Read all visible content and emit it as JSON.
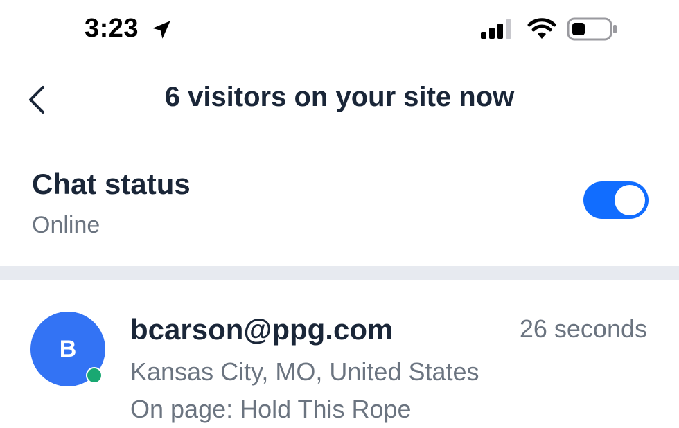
{
  "status_bar": {
    "time": "3:23",
    "location_icon": "location-arrow-icon",
    "signal_icon": "cellular-signal-icon",
    "wifi_icon": "wifi-icon",
    "battery_icon": "battery-icon",
    "battery_level_fraction": 0.3
  },
  "header": {
    "back_icon": "chevron-left-icon",
    "title": "6 visitors on your site now"
  },
  "chat_status": {
    "title": "Chat status",
    "status": "Online",
    "toggle_on": true,
    "toggle_color": "#116dff"
  },
  "visitors": [
    {
      "initial": "B",
      "email": "bcarson@ppg.com",
      "time_ago": "26 seconds",
      "location": "Kansas City, MO, United States",
      "page": "On page: Hold This Rope",
      "online": true,
      "avatar_color": "#3373f4",
      "online_color": "#19a872"
    }
  ],
  "colors": {
    "divider": "#e7eaf0",
    "primary_text": "#1a2638",
    "secondary_text": "#6b7480"
  }
}
